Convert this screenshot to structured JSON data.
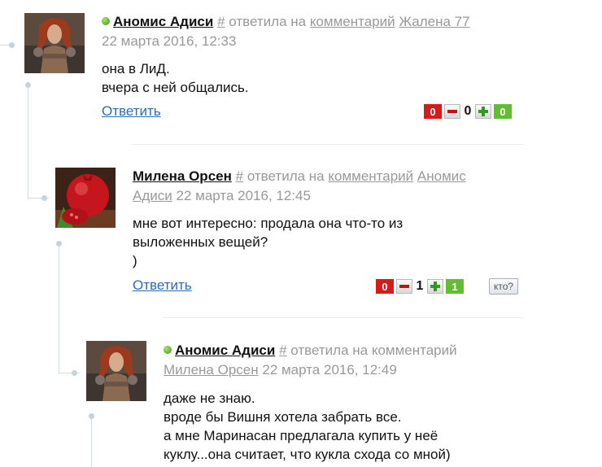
{
  "comments": [
    {
      "author": "Аномис Адиси",
      "hash": "#",
      "replied": "ответила на",
      "comment_link": "комментарий",
      "reply_to": "Жалена 77",
      "date": "22 марта 2016, 12:33",
      "lines": [
        "она в ЛиД.",
        "вчера с ней общались."
      ],
      "reply_label": "Ответить",
      "votes_against": "0",
      "score": "0",
      "votes_for": "0"
    },
    {
      "author": "Милена Орсен",
      "hash": "#",
      "replied": "ответила на",
      "comment_link": "комментарий",
      "reply_to_1": "Аномис",
      "reply_to_2": "Адиси",
      "date": "22 марта 2016, 12:45",
      "lines": [
        "мне вот интересно: продала она что-то из",
        "выложенных вещей?",
        ")"
      ],
      "reply_label": "Ответить",
      "votes_against": "0",
      "score": "1",
      "votes_for": "1",
      "who_label": "кто?"
    },
    {
      "author": "Аномис Адиси",
      "hash": "#",
      "replied_line": "ответила на комментарий",
      "reply_to": "Милена Орсен",
      "date": "22 марта 2016, 12:49",
      "lines": [
        "даже не знаю.",
        "вроде бы Вишня хотела забрать все.",
        "а мне Маринасан предлагала купить у неё",
        "куклу...она считает, что кукла схода со мной)"
      ]
    }
  ],
  "colors": {
    "link": "#2a6cb5",
    "meta": "#999999",
    "vote_against": "#d71a1a",
    "vote_for": "#63bd32",
    "online": "#3d9a10"
  }
}
